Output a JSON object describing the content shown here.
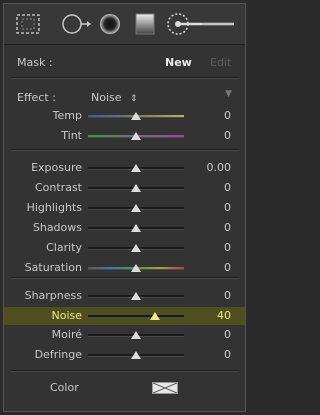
{
  "toolbar": {
    "tools": [
      {
        "name": "crop-overlay-tool-icon"
      },
      {
        "name": "spot-removal-tool-icon"
      },
      {
        "name": "red-eye-tool-icon"
      },
      {
        "name": "graduated-filter-tool-icon"
      },
      {
        "name": "adjustment-brush-tool-icon"
      }
    ]
  },
  "mask": {
    "label": "Mask :",
    "new_label": "New",
    "edit_label": "Edit"
  },
  "effect": {
    "label": "Effect :",
    "value": "Noise",
    "chevron": "⇕",
    "collapse_icon": "▼"
  },
  "groups": [
    [
      {
        "label": "Temp",
        "value": "0",
        "level": 0.5,
        "track": "temp"
      },
      {
        "label": "Tint",
        "value": "0",
        "level": 0.5,
        "track": "tint"
      }
    ],
    [
      {
        "label": "Exposure",
        "value": "0.00",
        "level": 0.5,
        "track": "gray"
      },
      {
        "label": "Contrast",
        "value": "0",
        "level": 0.5,
        "track": "gray"
      },
      {
        "label": "Highlights",
        "value": "0",
        "level": 0.5,
        "track": "gray"
      },
      {
        "label": "Shadows",
        "value": "0",
        "level": 0.5,
        "track": "gray"
      },
      {
        "label": "Clarity",
        "value": "0",
        "level": 0.5,
        "track": "gray"
      },
      {
        "label": "Saturation",
        "value": "0",
        "level": 0.5,
        "track": "sat"
      }
    ],
    [
      {
        "label": "Sharpness",
        "value": "0",
        "level": 0.5,
        "track": "gray"
      },
      {
        "label": "Noise",
        "value": "40",
        "level": 0.7,
        "track": "gray",
        "active": true
      },
      {
        "label": "Moiré",
        "value": "0",
        "level": 0.5,
        "track": "gray"
      },
      {
        "label": "Defringe",
        "value": "0",
        "level": 0.5,
        "track": "gray"
      }
    ]
  ],
  "color": {
    "label": "Color"
  },
  "colors": {
    "panel_bg": "#333333",
    "highlight_bg": "#4e4e1e",
    "highlight_text": "#f0e98a"
  }
}
